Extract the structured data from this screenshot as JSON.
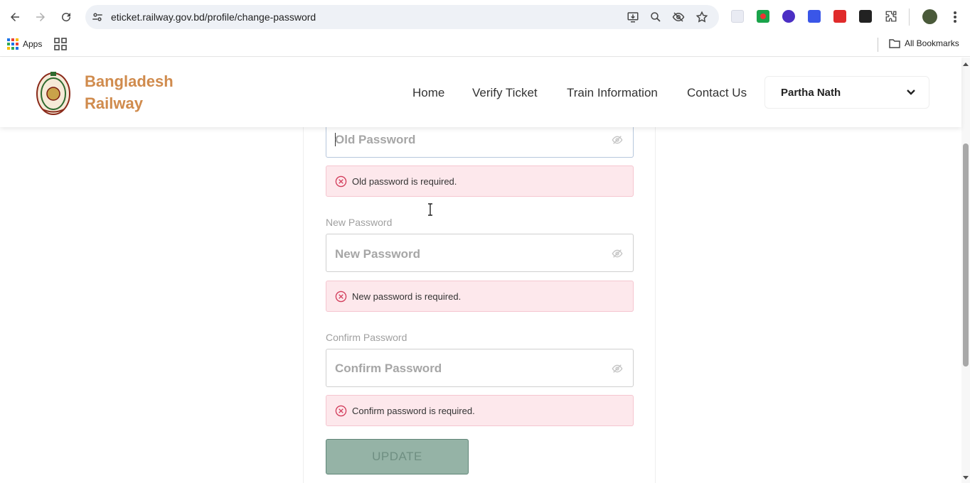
{
  "browser": {
    "url": "eticket.railway.gov.bd/profile/change-password",
    "bookmarks": {
      "apps_label": "Apps",
      "all_bookmarks_label": "All Bookmarks"
    }
  },
  "site": {
    "brand_line1": "Bangladesh",
    "brand_line2": "Railway",
    "nav": {
      "home": "Home",
      "verify_ticket": "Verify Ticket",
      "train_information": "Train Information",
      "contact_us": "Contact Us"
    },
    "user_name": "Partha Nath"
  },
  "form": {
    "old_password": {
      "placeholder": "Old Password",
      "error": "Old password is required."
    },
    "new_password": {
      "label": "New Password",
      "placeholder": "New Password",
      "error": "New password is required."
    },
    "confirm_password": {
      "label": "Confirm Password",
      "placeholder": "Confirm Password",
      "error": "Confirm password is required."
    },
    "submit_label": "UPDATE"
  },
  "colors": {
    "brand": "#d08b4d",
    "error_bg": "#fde8ec",
    "error_icon": "#d23b5a",
    "button_bg": "#95b3a6"
  }
}
